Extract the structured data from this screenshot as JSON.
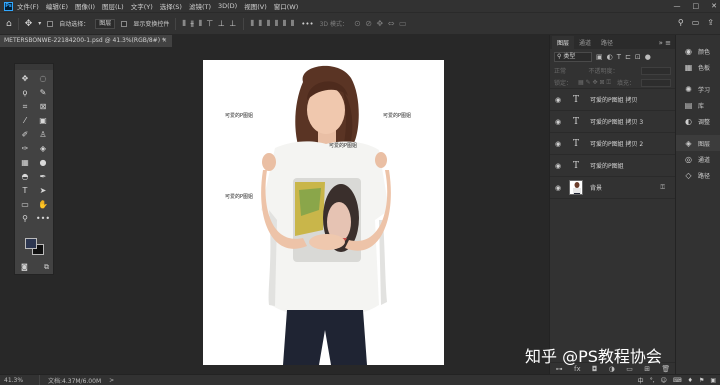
{
  "menu": {
    "items": [
      "文件(F)",
      "编辑(E)",
      "图像(I)",
      "图层(L)",
      "文字(Y)",
      "选择(S)",
      "滤镜(T)",
      "3D(D)",
      "视图(V)",
      "窗口(W)"
    ],
    "window_controls": [
      "—",
      "□",
      "✕"
    ]
  },
  "options": {
    "auto_select_label": "自动选择：",
    "auto_select_value": "图层",
    "show_transform_label": "显示变换控件",
    "mode_3d_label": "3D 模式："
  },
  "document": {
    "tab_title": "METERSBONWE-22184200-1.psd @ 41.3%(RGB/8#) *",
    "close_glyph": "×"
  },
  "canvas": {
    "texts": [
      "可爱的P图姐",
      "可爱的P图姐",
      "可爱的P图姐",
      "可爱的P图姐"
    ]
  },
  "layers_panel": {
    "tabs": [
      "图层",
      "通道",
      "路径"
    ],
    "filter_label": "类型",
    "blend_mode": "正常",
    "opacity_label": "不透明度：",
    "lock_label": "锁定：",
    "fill_label": "填充：",
    "layers": [
      {
        "name": "可爱的P图姐 拷贝",
        "kind": "text"
      },
      {
        "name": "可爱的P图姐 拷贝 3",
        "kind": "text"
      },
      {
        "name": "可爱的P图姐 拷贝 2",
        "kind": "text"
      },
      {
        "name": "可爱的P图姐",
        "kind": "text"
      },
      {
        "name": "背景",
        "kind": "image",
        "locked": true
      }
    ],
    "text_thumb_glyph": "T",
    "eye_glyph": "◉"
  },
  "side_strip": {
    "items": [
      {
        "label": "颜色",
        "icon": "color-wheel-icon"
      },
      {
        "label": "色板",
        "icon": "swatches-grid-icon"
      },
      {
        "label": "学习",
        "icon": "lightbulb-icon"
      },
      {
        "label": "库",
        "icon": "library-icon"
      },
      {
        "label": "调整",
        "icon": "adjustment-circle-icon"
      },
      {
        "label": "图层",
        "icon": "layers-stack-icon"
      },
      {
        "label": "通道",
        "icon": "channels-icon"
      },
      {
        "label": "路径",
        "icon": "path-icon"
      }
    ]
  },
  "status": {
    "zoom": "41.3%",
    "doc_info": "文档:4.37M/6.00M",
    "arrow": ">"
  },
  "tray": {
    "ime": "中",
    "items": [
      "°,",
      "☺",
      "⌨",
      "♦",
      "⚑",
      "▣"
    ]
  },
  "watermark": "知乎 @PS教程协会",
  "colors": {
    "foreground_swatch": "#2c3650",
    "background_swatch": "#111111",
    "panel_bg": "#323232",
    "workspace_bg": "#282828"
  }
}
